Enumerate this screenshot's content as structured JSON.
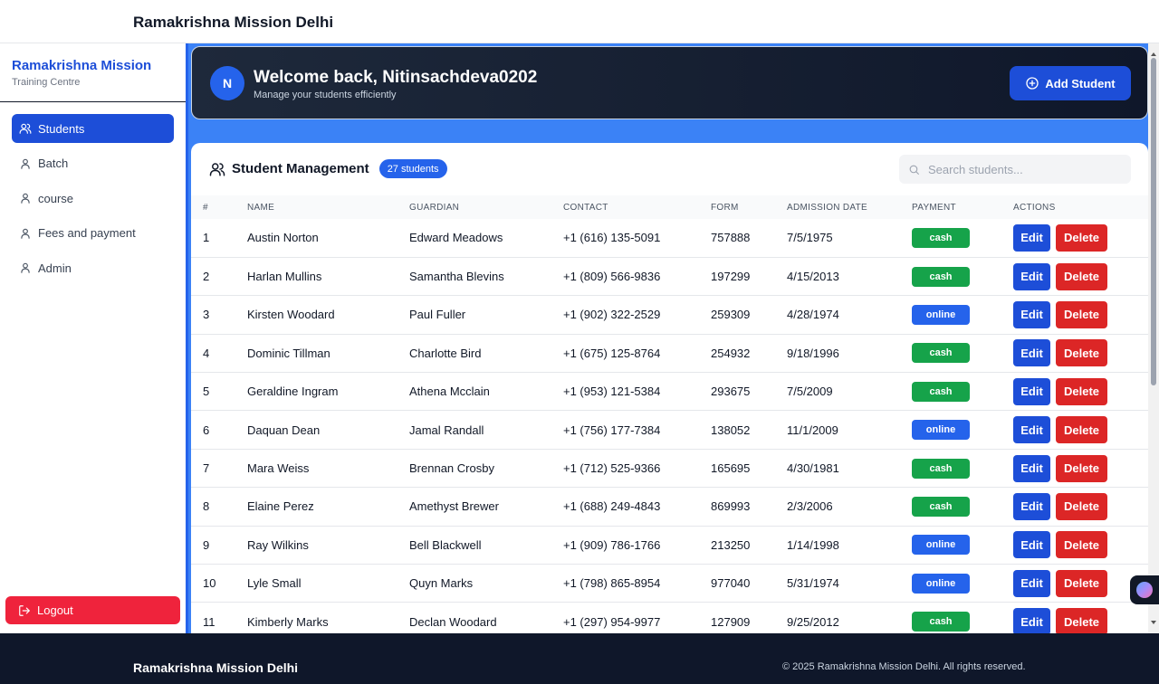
{
  "header": {
    "title": "Ramakrishna Mission Delhi"
  },
  "sidebar": {
    "brand_title": "Ramakrishna Mission",
    "brand_subtitle": "Training Centre",
    "items": [
      {
        "label": "Students",
        "icon": "users-icon",
        "active": true
      },
      {
        "label": "Batch",
        "icon": "user-icon",
        "active": false
      },
      {
        "label": "course",
        "icon": "user-icon",
        "active": false
      },
      {
        "label": "Fees and payment",
        "icon": "user-icon",
        "active": false
      },
      {
        "label": "Admin",
        "icon": "user-icon",
        "active": false
      }
    ],
    "logout_label": "Logout"
  },
  "welcome": {
    "avatar_initial": "N",
    "title": "Welcome back, Nitinsachdeva0202",
    "subtitle": "Manage your students efficiently",
    "add_button_label": "Add Student"
  },
  "panel": {
    "title": "Student Management",
    "count_badge": "27 students",
    "search_placeholder": "Search students...",
    "columns": [
      "#",
      "NAME",
      "GUARDIAN",
      "CONTACT",
      "FORM",
      "ADMISSION DATE",
      "PAYMENT",
      "ACTIONS"
    ],
    "edit_label": "Edit",
    "delete_label": "Delete",
    "rows": [
      {
        "num": "1",
        "name": "Austin Norton",
        "guardian": "Edward Meadows",
        "contact": "+1 (616) 135-5091",
        "form": "757888",
        "date": "7/5/1975",
        "payment": "cash"
      },
      {
        "num": "2",
        "name": "Harlan Mullins",
        "guardian": "Samantha Blevins",
        "contact": "+1 (809) 566-9836",
        "form": "197299",
        "date": "4/15/2013",
        "payment": "cash"
      },
      {
        "num": "3",
        "name": "Kirsten Woodard",
        "guardian": "Paul Fuller",
        "contact": "+1 (902) 322-2529",
        "form": "259309",
        "date": "4/28/1974",
        "payment": "online"
      },
      {
        "num": "4",
        "name": "Dominic Tillman",
        "guardian": "Charlotte Bird",
        "contact": "+1 (675) 125-8764",
        "form": "254932",
        "date": "9/18/1996",
        "payment": "cash"
      },
      {
        "num": "5",
        "name": "Geraldine Ingram",
        "guardian": "Athena Mcclain",
        "contact": "+1 (953) 121-5384",
        "form": "293675",
        "date": "7/5/2009",
        "payment": "cash"
      },
      {
        "num": "6",
        "name": "Daquan Dean",
        "guardian": "Jamal Randall",
        "contact": "+1 (756) 177-7384",
        "form": "138052",
        "date": "11/1/2009",
        "payment": "online"
      },
      {
        "num": "7",
        "name": "Mara Weiss",
        "guardian": "Brennan Crosby",
        "contact": "+1 (712) 525-9366",
        "form": "165695",
        "date": "4/30/1981",
        "payment": "cash"
      },
      {
        "num": "8",
        "name": "Elaine Perez",
        "guardian": "Amethyst Brewer",
        "contact": "+1 (688) 249-4843",
        "form": "869993",
        "date": "2/3/2006",
        "payment": "cash"
      },
      {
        "num": "9",
        "name": "Ray Wilkins",
        "guardian": "Bell Blackwell",
        "contact": "+1 (909) 786-1766",
        "form": "213250",
        "date": "1/14/1998",
        "payment": "online"
      },
      {
        "num": "10",
        "name": "Lyle Small",
        "guardian": "Quyn Marks",
        "contact": "+1 (798) 865-8954",
        "form": "977040",
        "date": "5/31/1974",
        "payment": "online"
      },
      {
        "num": "11",
        "name": "Kimberly Marks",
        "guardian": "Declan Woodard",
        "contact": "+1 (297) 954-9977",
        "form": "127909",
        "date": "9/25/2012",
        "payment": "cash"
      }
    ]
  },
  "footer": {
    "title": "Ramakrishna Mission Delhi",
    "copyright": "© 2025 Ramakrishna Mission Delhi. All rights reserved."
  },
  "colors": {
    "accent": "#1d4ed8",
    "main_bg": "#3b82f6",
    "cash": "#16a34a",
    "online": "#2563eb",
    "delete": "#dc2626",
    "logout": "#ef233c",
    "footer": "#0f172a"
  }
}
